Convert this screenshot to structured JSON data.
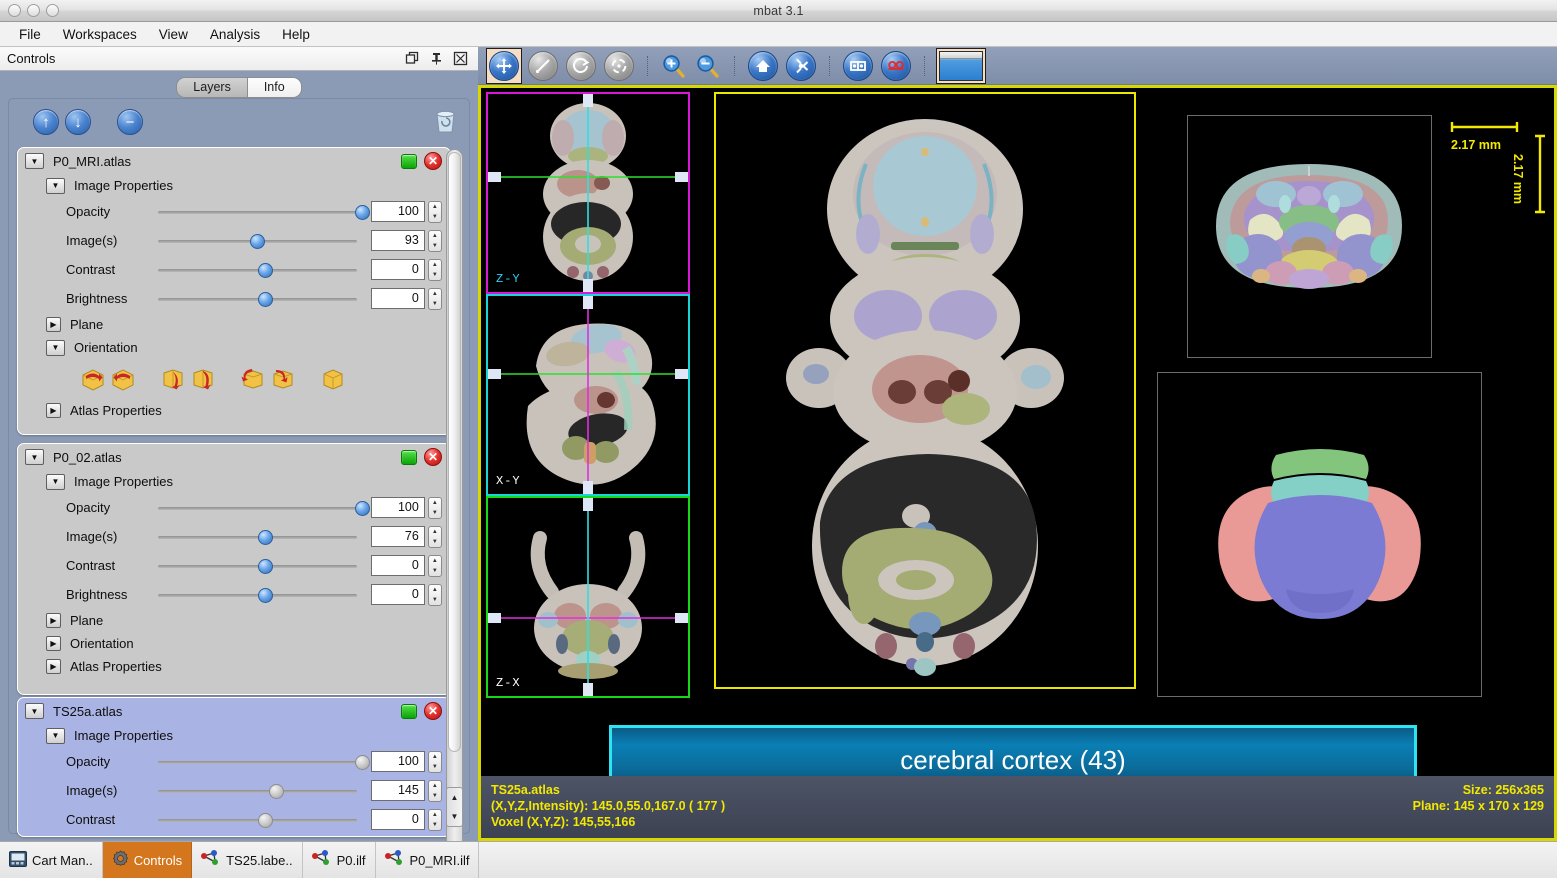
{
  "window": {
    "title": "mbat 3.1"
  },
  "menubar": {
    "items": [
      "File",
      "Workspaces",
      "View",
      "Analysis",
      "Help"
    ]
  },
  "controls_panel": {
    "header_title": "Controls",
    "header_icons": [
      "float-icon",
      "pin-icon",
      "close-icon"
    ],
    "tabs": [
      {
        "label": "Layers",
        "active": true
      },
      {
        "label": "Info",
        "active": false
      }
    ],
    "toolbar": {
      "move_up_label": "↑",
      "move_down_label": "↓",
      "remove_label": "−",
      "trash_label": "trash"
    },
    "layers": [
      {
        "name": "P0_MRI.atlas",
        "selected": false,
        "expanded": true,
        "image_properties_label": "Image Properties",
        "properties": [
          {
            "label": "Opacity",
            "value": "100",
            "pos": 100
          },
          {
            "label": "Image(s)",
            "value": "93",
            "pos": 47
          },
          {
            "label": "Contrast",
            "value": "0",
            "pos": 51
          },
          {
            "label": "Brightness",
            "value": "0",
            "pos": 51
          }
        ],
        "sections": [
          {
            "label": "Plane",
            "expanded": false
          },
          {
            "label": "Orientation",
            "expanded": true
          },
          {
            "label": "Atlas Properties",
            "expanded": false
          }
        ],
        "orientation_icons": [
          "flip-horizontal-icon",
          "flip-horizontal-reverse-icon",
          "rotate-y-forward-icon",
          "rotate-y-back-icon",
          "rotate-z-left-icon",
          "rotate-z-right-icon",
          "reset-orientation-icon"
        ]
      },
      {
        "name": "P0_02.atlas",
        "selected": false,
        "expanded": true,
        "image_properties_label": "Image Properties",
        "properties": [
          {
            "label": "Opacity",
            "value": "100",
            "pos": 100
          },
          {
            "label": "Image(s)",
            "value": "76",
            "pos": 51
          },
          {
            "label": "Contrast",
            "value": "0",
            "pos": 51
          },
          {
            "label": "Brightness",
            "value": "0",
            "pos": 51
          }
        ],
        "sections": [
          {
            "label": "Plane",
            "expanded": false
          },
          {
            "label": "Orientation",
            "expanded": false
          },
          {
            "label": "Atlas Properties",
            "expanded": false
          }
        ],
        "orientation_icons": []
      },
      {
        "name": "TS25a.atlas",
        "selected": true,
        "expanded": true,
        "image_properties_label": "Image Properties",
        "properties": [
          {
            "label": "Opacity",
            "value": "100",
            "pos": 100
          },
          {
            "label": "Image(s)",
            "value": "145",
            "pos": 55
          },
          {
            "label": "Contrast",
            "value": "0",
            "pos": 51
          }
        ],
        "sections": [],
        "orientation_icons": []
      }
    ]
  },
  "viewer": {
    "toolbar": [
      {
        "name": "pan-tool-icon",
        "glyph": "✥",
        "style": "blue",
        "selected": true
      },
      {
        "name": "measure-tool-icon",
        "glyph": "╱",
        "style": "gray",
        "selected": false
      },
      {
        "name": "rotate-tool-icon",
        "glyph": "↻",
        "style": "gray",
        "selected": false
      },
      {
        "name": "orbit-tool-icon",
        "glyph": "◌",
        "style": "gray",
        "selected": false
      },
      {
        "name": "zoom-in-icon",
        "glyph": "+",
        "style": "magnifier",
        "selected": false
      },
      {
        "name": "zoom-out-icon",
        "glyph": "−",
        "style": "magnifier",
        "selected": false
      },
      {
        "name": "home-view-icon",
        "glyph": "⌂",
        "style": "blue",
        "selected": false
      },
      {
        "name": "fit-to-window-icon",
        "glyph": "✣",
        "style": "blue",
        "selected": false
      },
      {
        "name": "mirror-x-icon",
        "glyph": "⧉",
        "style": "blue",
        "selected": false
      },
      {
        "name": "mirror-y-icon",
        "glyph": "≡",
        "style": "blue",
        "selected": false
      },
      {
        "name": "window-layout-icon",
        "glyph": "",
        "style": "window",
        "selected": true
      }
    ],
    "thumbnails": [
      {
        "label": "Z-Y",
        "border_color": "#d917d9",
        "label_color": "#2fd0ff"
      },
      {
        "label": "X-Y",
        "border_color": "#18d4d4",
        "label_color": "#ffffff"
      },
      {
        "label": "Z-X",
        "border_color": "#16d816",
        "label_color": "#ffffff"
      }
    ],
    "scale_bar": {
      "horizontal_label": "2.17 mm",
      "vertical_label": "2.17 mm",
      "color": "#f2e800"
    },
    "structure_banner": {
      "label": "cerebral cortex (43)",
      "fill_color": "#0a7fb4",
      "border_color": "#2fe4f2"
    },
    "status": {
      "layer_name": "TS25a.atlas",
      "coordinates": "(X,Y,Z,Intensity): 145.0,55.0,167.0  ( 177 )",
      "voxel": "Voxel (X,Y,Z): 145,55,166",
      "size": "Size: 256x365",
      "plane": "Plane: 145 x 170 x 129",
      "text_color": "#f2e800"
    }
  },
  "taskbar": {
    "items": [
      {
        "label": "Cart Man..",
        "icon": "cart-manager-icon",
        "active": false
      },
      {
        "label": "Controls",
        "icon": "gear-icon",
        "active": true
      },
      {
        "label": "TS25.labe..",
        "icon": "molecule-icon",
        "active": false
      },
      {
        "label": "P0.ilf",
        "icon": "molecule-icon",
        "active": false
      },
      {
        "label": "P0_MRI.ilf",
        "icon": "molecule-icon",
        "active": false
      }
    ]
  }
}
